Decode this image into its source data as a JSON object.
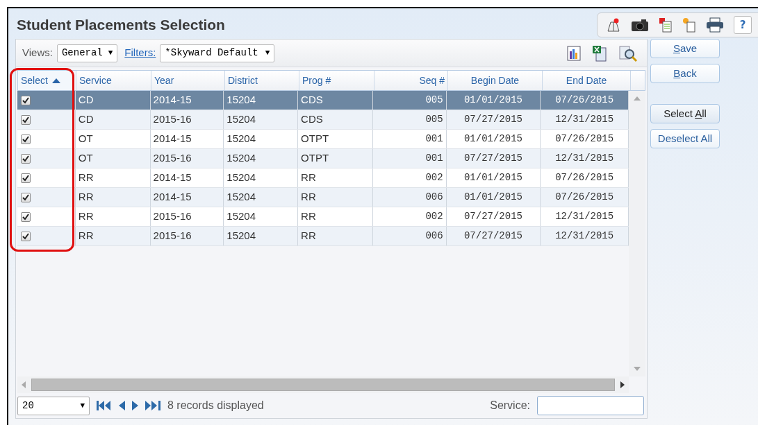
{
  "window": {
    "title": "Student Placements Selection"
  },
  "help_label": "?",
  "filters": {
    "views_label": "Views:",
    "views_value": "General",
    "filters_link": "Filters:",
    "filters_value": "*Skyward Default",
    "dropdown_arrow": "▼"
  },
  "grid": {
    "select_column": {
      "label": "Select",
      "sorted": true
    },
    "columns": [
      {
        "label": "Service",
        "sorted": false
      },
      {
        "label": "Year",
        "sorted": false
      },
      {
        "label": "District",
        "sorted": false
      },
      {
        "label": "Prog #",
        "sorted": false
      },
      {
        "label": "Seq #",
        "sorted": false
      },
      {
        "label": "Begin Date",
        "sorted": false
      },
      {
        "label": "End Date",
        "sorted": false
      }
    ],
    "rows": [
      {
        "selected": true,
        "checked": true,
        "cells": [
          "CD",
          "2014-15",
          "15204",
          "CDS",
          "005",
          "01/01/2015",
          "07/26/2015"
        ]
      },
      {
        "selected": false,
        "checked": true,
        "cells": [
          "CD",
          "2015-16",
          "15204",
          "CDS",
          "005",
          "07/27/2015",
          "12/31/2015"
        ]
      },
      {
        "selected": false,
        "checked": true,
        "cells": [
          "OT",
          "2014-15",
          "15204",
          "OTPT",
          "001",
          "01/01/2015",
          "07/26/2015"
        ]
      },
      {
        "selected": false,
        "checked": true,
        "cells": [
          "OT",
          "2015-16",
          "15204",
          "OTPT",
          "001",
          "07/27/2015",
          "12/31/2015"
        ]
      },
      {
        "selected": false,
        "checked": true,
        "cells": [
          "RR",
          "2014-15",
          "15204",
          "RR",
          "002",
          "01/01/2015",
          "07/26/2015"
        ]
      },
      {
        "selected": false,
        "checked": true,
        "cells": [
          "RR",
          "2014-15",
          "15204",
          "RR",
          "006",
          "01/01/2015",
          "07/26/2015"
        ]
      },
      {
        "selected": false,
        "checked": true,
        "cells": [
          "RR",
          "2015-16",
          "15204",
          "RR",
          "002",
          "07/27/2015",
          "12/31/2015"
        ]
      },
      {
        "selected": false,
        "checked": true,
        "cells": [
          "RR",
          "2015-16",
          "15204",
          "RR",
          "006",
          "07/27/2015",
          "12/31/2015"
        ]
      }
    ]
  },
  "footer": {
    "page_size": "20",
    "records": "8 records displayed",
    "service_label": "Service:"
  },
  "side_buttons": [
    {
      "label": "Save"
    },
    {
      "label": "Back"
    },
    {
      "label": "Select All"
    },
    {
      "label": "Deselect All"
    }
  ]
}
